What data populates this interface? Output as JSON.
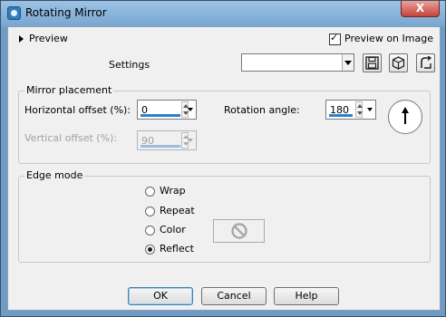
{
  "window": {
    "title": "Rotating Mirror",
    "close_label": "X"
  },
  "preview": {
    "toggle_label": "Preview",
    "preview_on_image_label": "Preview on Image",
    "preview_on_image_checked": true
  },
  "settings": {
    "label": "Settings",
    "value": ""
  },
  "mirror_placement": {
    "group_label": "Mirror placement",
    "horizontal_offset_label": "Horizontal offset (%):",
    "horizontal_offset_value": "0",
    "vertical_offset_label": "Vertical offset (%):",
    "vertical_offset_value": "90",
    "rotation_angle_label": "Rotation angle:",
    "rotation_angle_value": "180"
  },
  "edge_mode": {
    "group_label": "Edge mode",
    "options": [
      "Wrap",
      "Repeat",
      "Color",
      "Reflect"
    ],
    "selected": "Reflect"
  },
  "buttons": {
    "ok": "OK",
    "cancel": "Cancel",
    "help": "Help"
  },
  "icons": [
    "app-icon",
    "save-preset-icon",
    "load-preset-icon",
    "reset-icon",
    "no-color-icon",
    "angle-dial-icon"
  ]
}
